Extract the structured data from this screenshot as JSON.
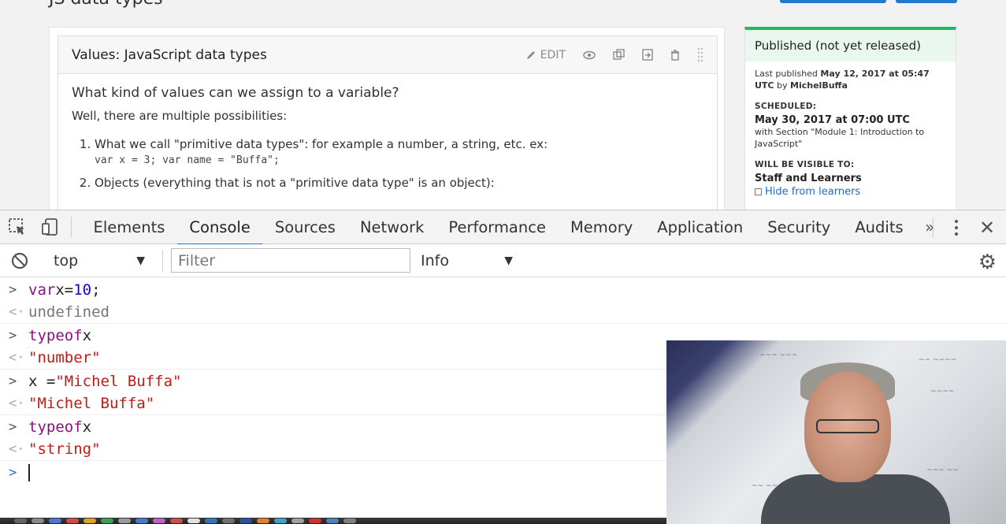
{
  "page": {
    "title": "JS data types",
    "unit": {
      "block_title": "Values: JavaScript data types",
      "edit_label": "EDIT",
      "question": "What kind of values can we assign to a variable?",
      "intro": "Well, there are multiple possibilities:",
      "items": [
        {
          "text": "What we call \"primitive data types\": for example a number, a string, etc. ex:",
          "code": "var x = 3; var name = \"Buffa\";"
        },
        {
          "text": "Objects (everything that is not a  \"primitive data type\" is an object):",
          "code": ""
        }
      ]
    },
    "sidebar": {
      "status": "Published (not yet released)",
      "last_published_prefix": "Last published",
      "last_published_date": "May 12, 2017 at 05:47 UTC",
      "last_published_by": "by",
      "last_published_user": "MichelBuffa",
      "scheduled_label": "SCHEDULED:",
      "scheduled_date": "May 30, 2017 at 07:00 UTC",
      "scheduled_with": "with Section \"Module 1: Introduction to JavaScript\"",
      "visible_label": "WILL BE VISIBLE TO:",
      "visible_value": "Staff and Learners",
      "hide_link": "Hide from learners"
    }
  },
  "devtools": {
    "tabs": [
      "Elements",
      "Console",
      "Sources",
      "Network",
      "Performance",
      "Memory",
      "Application",
      "Security",
      "Audits"
    ],
    "active_tab": "Console",
    "more_label": "»",
    "close_label": "✕",
    "context": "top",
    "filter_placeholder": "Filter",
    "level": "Info"
  },
  "console": {
    "entries": [
      {
        "in": [
          "var",
          " x=",
          "10",
          ";"
        ],
        "out": "undefined"
      },
      {
        "in": [
          "typeof",
          " x"
        ],
        "out": "\"number\""
      },
      {
        "in": [
          "x = ",
          "\"Michel Buffa\""
        ],
        "out": "\"Michel Buffa\""
      },
      {
        "in": [
          "typeof",
          " x"
        ],
        "out": "\"string\""
      }
    ]
  },
  "icons": {
    "inspect": "inspect-element-icon",
    "device": "device-toggle-icon",
    "clear": "clear-console-icon",
    "gear": "settings-gear-icon"
  },
  "colors": {
    "accent": "#1a73e8",
    "published_green": "#25b85a",
    "string": "#c41a16",
    "number": "#1c00cf",
    "keyword": "#881280"
  }
}
